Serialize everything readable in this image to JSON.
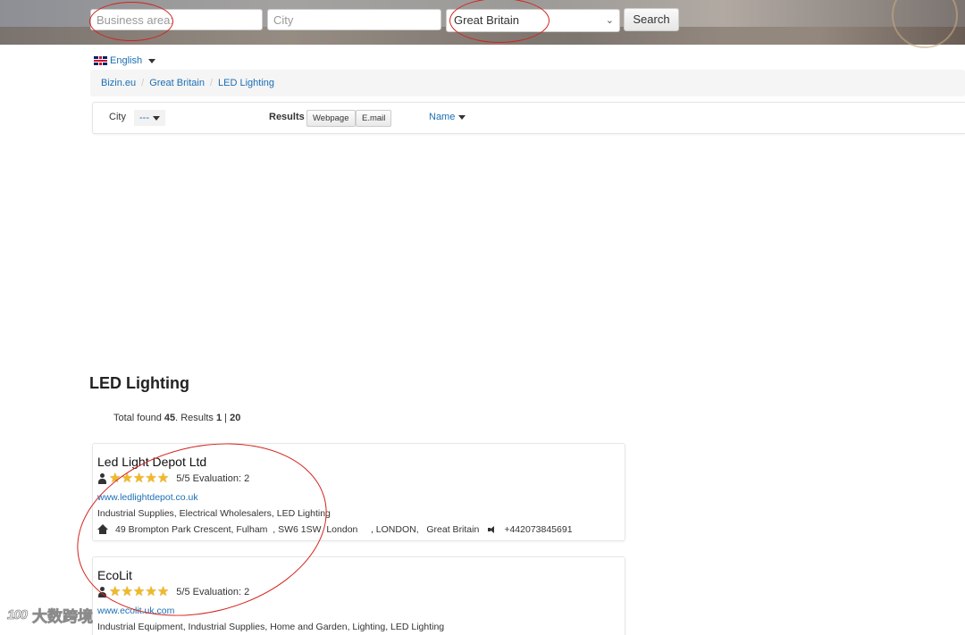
{
  "search": {
    "business_placeholder": "Business area:",
    "city_placeholder": "City",
    "country_selected": "Great Britain",
    "search_label": "Search"
  },
  "language": {
    "label": "English"
  },
  "breadcrumb": {
    "items": [
      "Bizin.eu",
      "Great Britain",
      "LED Lighting"
    ]
  },
  "filters": {
    "city_label": "City",
    "city_value": "---",
    "results_label": "Results",
    "webpage_label": "Webpage",
    "email_label": "E.mail",
    "sort_label": "Name"
  },
  "section": {
    "title": "LED Lighting",
    "total_prefix": "Total found ",
    "total_count": "45",
    "results_text": ". Results ",
    "results_page": "1",
    "results_sep": " | ",
    "results_per": "20"
  },
  "listings": [
    {
      "name": "Led Light Depot Ltd",
      "stars": 5,
      "rating_text": "5/5 Evaluation: 2",
      "website": "www.ledlightdepot.co.uk",
      "categories": "Industrial Supplies, Electrical Wholesalers, LED Lighting",
      "address": "49 Brompton Park Crescent, Fulham  , SW6 1SW  London     , LONDON,   Great Britain",
      "phone": "+442073845691"
    },
    {
      "name": "EcoLit",
      "stars": 5,
      "rating_text": "5/5 Evaluation: 2",
      "website": "www.ecolit.uk.com",
      "categories": "Industrial Equipment, Industrial Supplies, Home and Garden, Lighting, LED Lighting"
    }
  ],
  "watermark": {
    "logo": "100",
    "text": "大数跨境"
  },
  "colors": {
    "link": "#1b6fb5",
    "annotation": "#d3231d",
    "star": "#f2b827"
  }
}
